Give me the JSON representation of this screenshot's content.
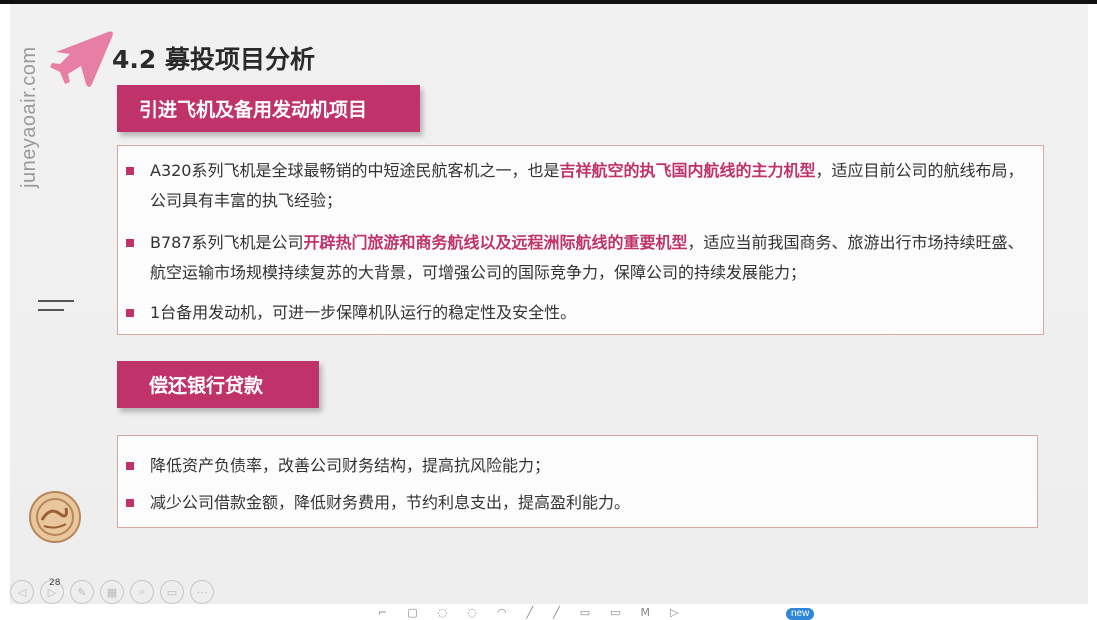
{
  "brand": {
    "side_text": "juneyaoair.com"
  },
  "slide": {
    "title": "4.2 募投项目分析",
    "section1": {
      "tag": "引进飞机及备用发动机项目",
      "items": [
        {
          "pre": "A320系列飞机是全球最畅销的中短途民航客机之一，也是",
          "highlight": "吉祥航空的执飞国内航线的主力机型",
          "post": "，适应目前公司的航线布局，公司具有丰富的执飞经验；"
        },
        {
          "pre": "B787系列飞机是公司",
          "highlight": "开辟热门旅游和商务航线以及远程洲际航线的重要机型",
          "post": "，适应当前我国商务、旅游出行市场持续旺盛、航空运输市场规模持续复苏的大背景，可增强公司的国际竞争力，保障公司的持续发展能力；"
        },
        {
          "pre": "1台备用发动机，可进一步保障机队运行的稳定性及安全性。",
          "highlight": "",
          "post": ""
        }
      ]
    },
    "section2": {
      "tag": "偿还银行贷款",
      "items": [
        {
          "text": "降低资产负债率，改善公司财务结构，提高抗风险能力；"
        },
        {
          "text": "减少公司借款金额，降低财务费用，节约利息支出，提高盈利能力。"
        }
      ]
    }
  },
  "player": {
    "page_number": "28",
    "controls": [
      "prev-icon",
      "next-icon",
      "pen-icon",
      "slides-icon",
      "zoom-icon",
      "subtitle-icon",
      "more-icon"
    ],
    "badge": "new"
  },
  "colors": {
    "accent": "#c0336a",
    "border": "#d8a6a0"
  }
}
